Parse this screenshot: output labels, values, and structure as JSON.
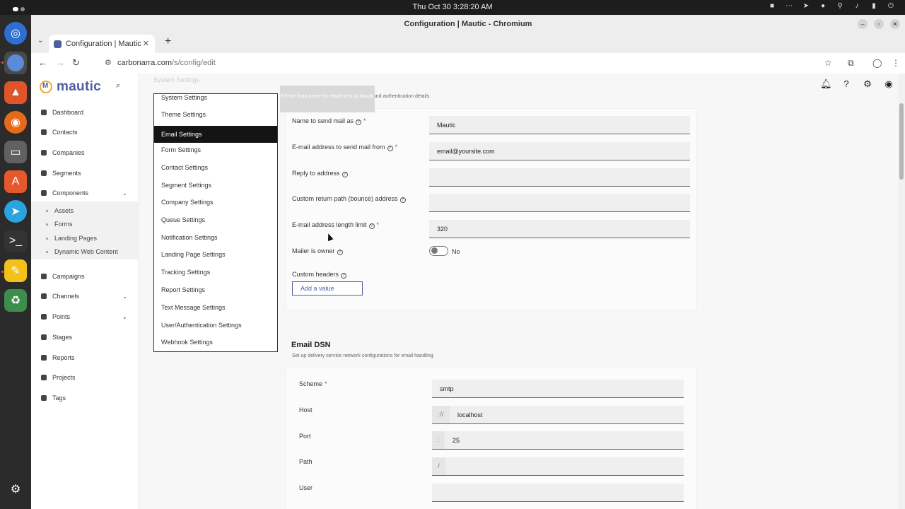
{
  "system": {
    "clock": "Thu Oct 30   3:28:20 AM"
  },
  "browser": {
    "window_title": "Configuration | Mautic - Chromium",
    "tab_title": "Configuration | Mautic",
    "url_host": "carbonarra.com",
    "url_path": "/s/config/edit"
  },
  "app": {
    "brand": "mautic",
    "nav": [
      {
        "label": "Dashboard"
      },
      {
        "label": "Contacts"
      },
      {
        "label": "Companies"
      },
      {
        "label": "Segments"
      },
      {
        "label": "Components"
      },
      {
        "label": "Campaigns"
      },
      {
        "label": "Channels"
      },
      {
        "label": "Points"
      },
      {
        "label": "Stages"
      },
      {
        "label": "Reports"
      },
      {
        "label": "Projects"
      },
      {
        "label": "Tags"
      }
    ],
    "components_sub": [
      {
        "label": "Assets"
      },
      {
        "label": "Forms"
      },
      {
        "label": "Landing Pages"
      },
      {
        "label": "Dynamic Web Content"
      }
    ]
  },
  "settings_menu": {
    "ghost_label": "System Settings",
    "items": [
      {
        "label": "System Settings"
      },
      {
        "label": "Theme Settings"
      },
      {
        "label": "Email Settings"
      },
      {
        "label": "Form Settings"
      },
      {
        "label": "Contact Settings"
      },
      {
        "label": "Segment Settings"
      },
      {
        "label": "Company Settings"
      },
      {
        "label": "Queue Settings"
      },
      {
        "label": "Notification Settings"
      },
      {
        "label": "Landing Page Settings"
      },
      {
        "label": "Tracking Settings"
      },
      {
        "label": "Report Settings"
      },
      {
        "label": "Text Message Settings"
      },
      {
        "label": "User/Authentication Settings"
      },
      {
        "label": "Webhook Settings"
      }
    ],
    "active": "Email Settings"
  },
  "tooltip": {
    "text": "Set the from name for email sent by Mautic"
  },
  "mail_send": {
    "description": "Configure email sending parameters and authentication details.",
    "from_name": {
      "label": "Name to send mail as",
      "value": "Mautic"
    },
    "from_email": {
      "label": "E-mail address to send mail from",
      "value": "email@yoursite.com"
    },
    "reply_to": {
      "label": "Reply to address",
      "value": ""
    },
    "return_path": {
      "label": "Custom return path (bounce) address",
      "value": ""
    },
    "length_limit": {
      "label": "E-mail address length limit",
      "value": "320"
    },
    "mailer_is_owner": {
      "label": "Mailer is owner",
      "value": "No"
    },
    "custom_headers": {
      "label": "Custom headers",
      "add_label": "Add a value"
    }
  },
  "email_dsn": {
    "title": "Email DSN",
    "description": "Set up delivery service network configurations for email handling.",
    "scheme": {
      "label": "Scheme",
      "value": "smtp"
    },
    "host": {
      "label": "Host",
      "prefix": "://",
      "value": "localhost"
    },
    "port": {
      "label": "Port",
      "prefix": ":",
      "value": "25"
    },
    "path": {
      "label": "Path",
      "prefix": "/",
      "value": ""
    },
    "user": {
      "label": "User",
      "value": ""
    }
  }
}
